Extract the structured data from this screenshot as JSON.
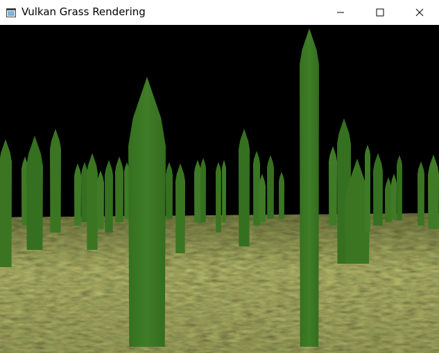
{
  "window": {
    "title": "Vulkan Grass Rendering",
    "controls": [
      "minimize-icon",
      "maximize-icon",
      "close-icon"
    ]
  },
  "scene": {
    "sky_color": "#000000",
    "ground_colors": [
      "#4a4a22",
      "#6b6a30",
      "#8a8848",
      "#3e4a1c",
      "#7a7438"
    ],
    "blade_colors": [
      "#3b7522",
      "#3f7b26",
      "#357020"
    ]
  }
}
